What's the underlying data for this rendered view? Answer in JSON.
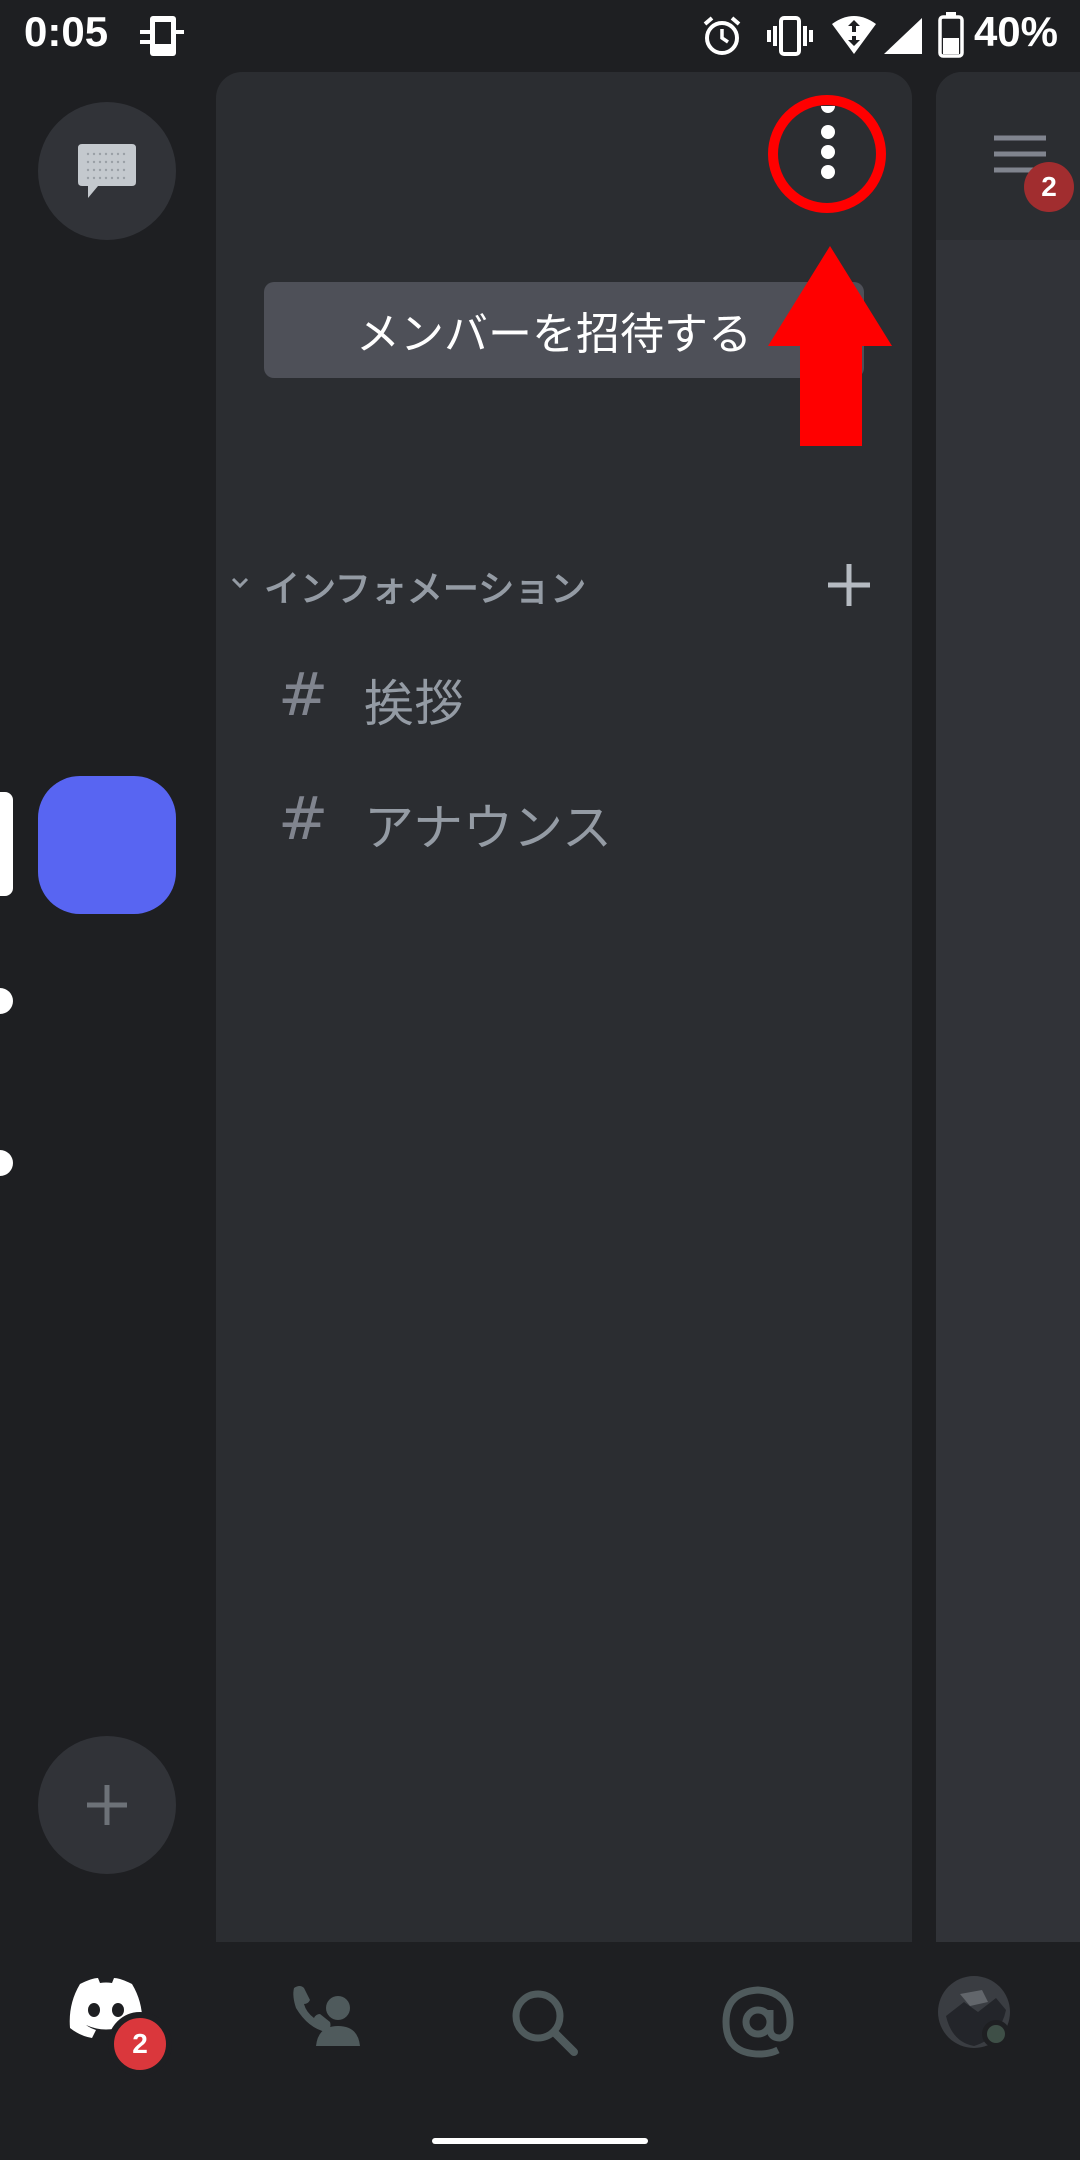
{
  "status_bar": {
    "time": "0:05",
    "battery_percent": "40%",
    "icons": [
      "cast-icon",
      "alarm-icon",
      "vibrate-icon",
      "wifi-icon",
      "cell-signal-icon",
      "battery-icon"
    ]
  },
  "server_rail": {
    "dm_icon": "chat-bubble-icon",
    "add_server_icon": "plus-icon",
    "active_server_color": "#5865f2"
  },
  "channel_panel": {
    "invite_button_label": "メンバーを招待する",
    "more_icon": "more-vertical-icon",
    "category": {
      "label": "インフォメーション",
      "add_icon": "plus-icon"
    },
    "channels": [
      {
        "name": "挨拶",
        "icon": "hash-icon"
      },
      {
        "name": "アナウンス",
        "icon": "hash-icon"
      }
    ]
  },
  "right_panel": {
    "menu_icon": "hamburger-icon",
    "badge_count": "2"
  },
  "bottom_nav": {
    "home_badge": "2",
    "items": [
      "discord-home-icon",
      "friends-icon",
      "search-icon",
      "mentions-icon",
      "profile-avatar"
    ]
  },
  "colors": {
    "background": "#1e1f22",
    "panel": "#2b2d31",
    "accent": "#5865f2",
    "badge": "#da373c",
    "annotation": "#ff0000"
  }
}
